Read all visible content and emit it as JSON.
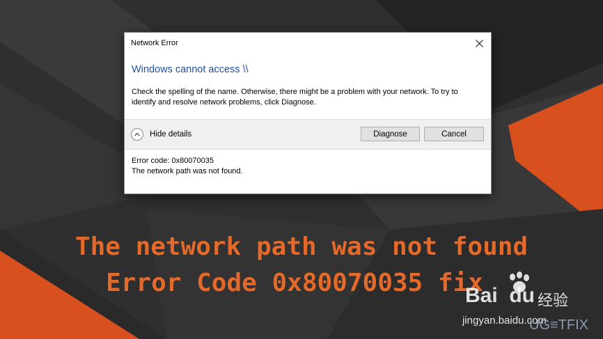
{
  "dialog": {
    "title": "Network Error",
    "heading": "Windows cannot access \\\\",
    "message": "Check the spelling of the name. Otherwise, there might be a problem with your network. To try to identify and resolve network problems, click Diagnose.",
    "details_toggle_label": "Hide details",
    "diagnose_label": "Diagnose",
    "cancel_label": "Cancel",
    "error_code": "Error code: 0x80070035",
    "error_description": "The network path was not found."
  },
  "caption": {
    "line1": "The network path was not found",
    "line2": "Error Code 0x80070035 fix"
  },
  "watermarks": {
    "baidu_logo": "Bai  du",
    "baidu_jingyan": "经验",
    "baidu_url": "jingyan.baidu.com",
    "ugetfix": "UG≡TFIX"
  },
  "colors": {
    "background": "#2b2b2b",
    "accent_orange": "#d9501f",
    "heading_blue": "#1e4fa8",
    "caption_orange": "#e26a2c"
  },
  "icons": [
    "close-icon",
    "chevron-up-icon",
    "baidu-paw-icon"
  ]
}
